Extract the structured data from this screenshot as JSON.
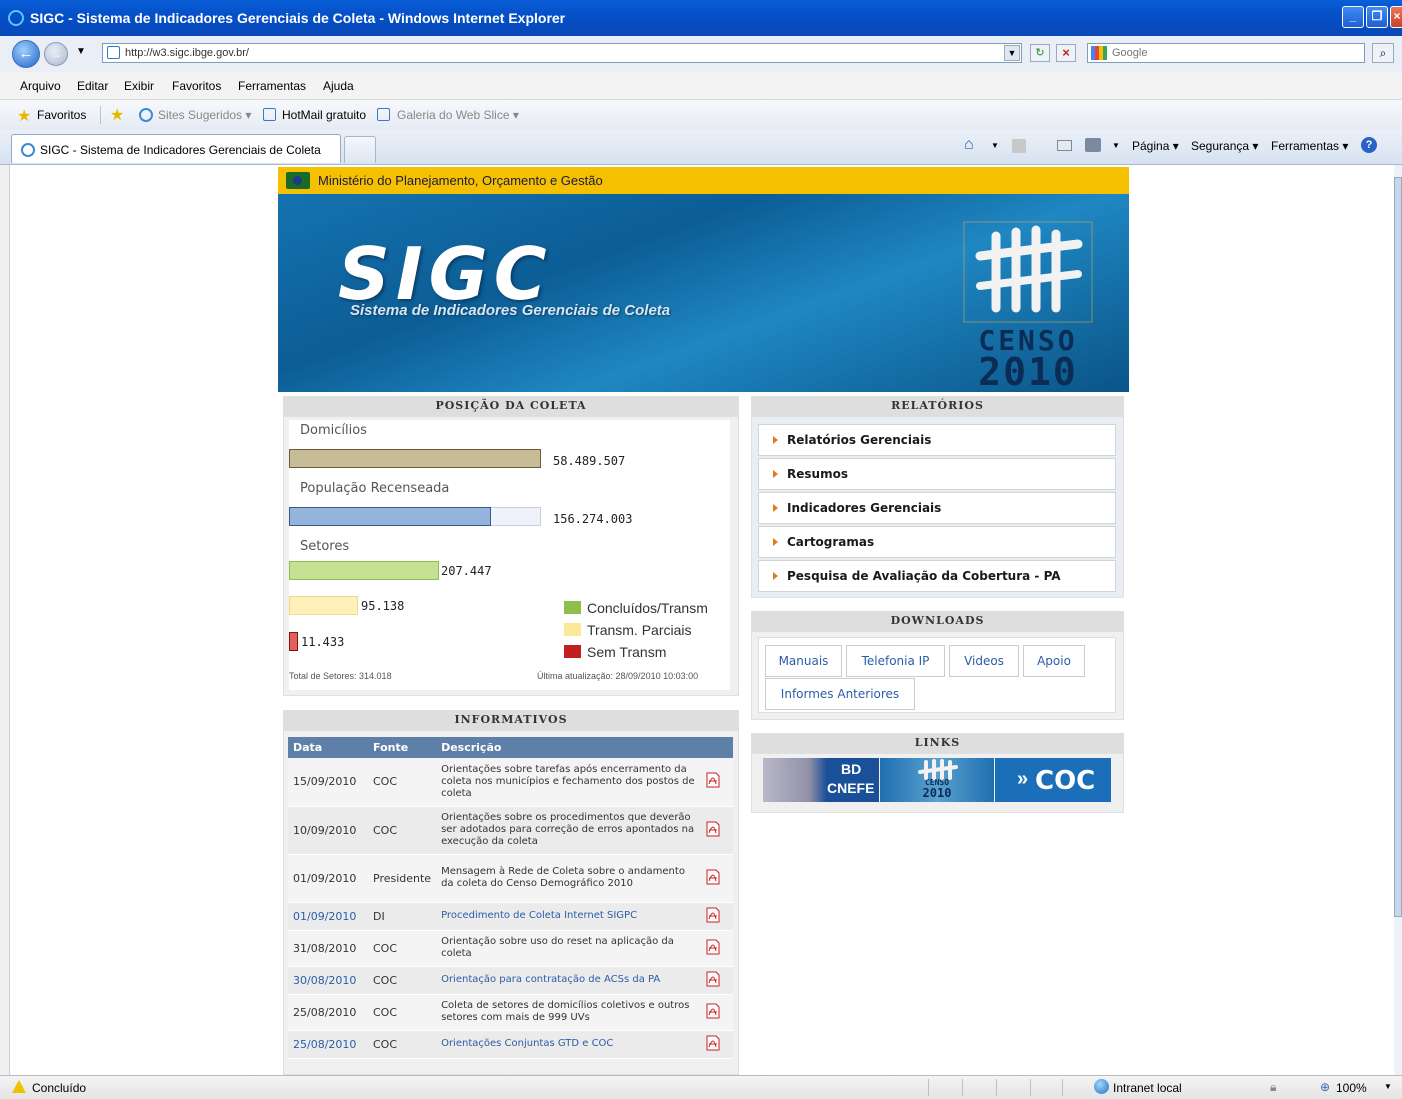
{
  "window": {
    "title": "SIGC - Sistema de Indicadores Gerenciais de Coleta - Windows Internet Explorer"
  },
  "address_bar": {
    "url": "http://w3.sigc.ibge.gov.br/",
    "search_placeholder": "Google"
  },
  "menubar": [
    "Arquivo",
    "Editar",
    "Exibir",
    "Favoritos",
    "Ferramentas",
    "Ajuda"
  ],
  "favorites_bar": {
    "favorites_label": "Favoritos",
    "items": [
      "Sites Sugeridos ▾",
      "HotMail gratuito",
      "Galeria do Web Slice ▾"
    ]
  },
  "tab": {
    "title": "SIGC - Sistema de Indicadores Gerenciais de Coleta"
  },
  "command_bar": {
    "pagina": "Página ▾",
    "seguranca": "Segurança ▾",
    "ferramentas": "Ferramentas ▾"
  },
  "page": {
    "ministry": "Ministério do Planejamento, Orçamento e Gestão",
    "banner_title": "SIGC",
    "banner_subtitle": "Sistema de Indicadores Gerenciais de Coleta",
    "censo_line1": "CENSO",
    "censo_line2": "2010",
    "posicao": {
      "header": "POSIÇÃO DA COLETA",
      "domicilios_label": "Domicílios",
      "domicilios_value": "58.489.507",
      "domicilios_fraction": 1.0,
      "populacao_label": "População Recenseada",
      "populacao_value": "156.274.003",
      "populacao_fraction": 0.8,
      "setores_label": "Setores",
      "concluidos_value": "207.447",
      "parciais_value": "95.138",
      "sem_value": "11.433",
      "legend_concluidos": "Concluídos/Transm",
      "legend_parciais": "Transm. Parciais",
      "legend_sem": "Sem Transm",
      "total_setores": "Total de Setores: 314.018",
      "ultima_atualizacao": "Última atualização: 28/09/2010 10:03:00"
    },
    "relatorios": {
      "header": "RELATÓRIOS",
      "items": [
        "Relatórios Gerenciais",
        "Resumos",
        "Indicadores Gerenciais",
        "Cartogramas",
        "Pesquisa de Avaliação da Cobertura - PA"
      ]
    },
    "downloads": {
      "header": "DOWNLOADS",
      "tabs": [
        "Manuais",
        "Telefonia IP",
        "Videos",
        "Apoio",
        "Informes Anteriores"
      ]
    },
    "links": {
      "header": "LINKS",
      "bd_cnefe_line1": "BD",
      "bd_cnefe_line2": "CNEFE",
      "censo_line1": "CENSO",
      "censo_line2": "2010",
      "coc": "COC"
    },
    "informativos": {
      "header": "INFORMATIVOS",
      "columns": [
        "Data",
        "Fonte",
        "Descrição"
      ],
      "rows": [
        {
          "data": "15/09/2010",
          "fonte": "COC",
          "descricao": "Orientações sobre tarefas após encerramento da coleta nos municípios e fechamento dos postos de coleta"
        },
        {
          "data": "10/09/2010",
          "fonte": "COC",
          "descricao": "Orientações sobre os procedimentos que deverão ser adotados para correção de erros apontados na execução da coleta"
        },
        {
          "data": "01/09/2010",
          "fonte": "Presidente",
          "descricao": "Mensagem à Rede de Coleta sobre o andamento da coleta do Censo Demográfico 2010"
        },
        {
          "data": "01/09/2010",
          "fonte": "DI",
          "descricao": "Procedimento de Coleta Internet SIGPC"
        },
        {
          "data": "31/08/2010",
          "fonte": "COC",
          "descricao": "Orientação sobre uso do reset na aplicação da coleta"
        },
        {
          "data": "30/08/2010",
          "fonte": "COC",
          "descricao": "Orientação para contratação de ACSs da PA"
        },
        {
          "data": "25/08/2010",
          "fonte": "COC",
          "descricao": "Coleta de setores de domicílios coletivos e outros setores com mais de 999 UVs"
        },
        {
          "data": "25/08/2010",
          "fonte": "COC",
          "descricao": "Orientações Conjuntas GTD e COC"
        }
      ]
    }
  },
  "statusbar": {
    "status": "Concluído",
    "zone": "Intranet local",
    "zoom": "100%"
  },
  "colors": {
    "concluidos": "#8cc04a",
    "parciais": "#fce89a",
    "sem": "#c02020",
    "domicilios": "#c8bb98",
    "populacao": "#95b4dc",
    "ministry_bar": "#f5c000"
  }
}
